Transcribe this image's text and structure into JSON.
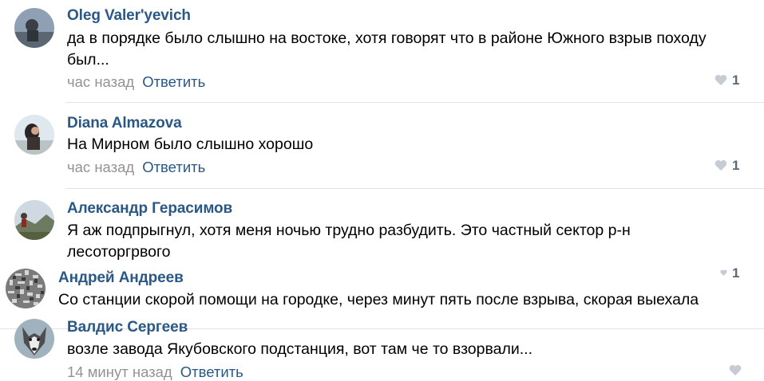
{
  "comments": [
    {
      "author": "Oleg Valer'yevich",
      "text_lines": [
        "да в порядке было слышно на востоке, хотя говорят что в районе Южного взрыв походу",
        "был..."
      ],
      "time": "час назад",
      "reply": "Ответить",
      "likes": "1"
    },
    {
      "author": "Diana Almazova",
      "text_lines": [
        "На Мирном было слышно хорошо"
      ],
      "time": "час назад",
      "reply": "Ответить",
      "likes": "1"
    },
    {
      "author": "Александр Герасимов",
      "text_lines": [
        "Я аж подпрыгнул, хотя меня ночью трудно разбудить. Это частный сектор р-н",
        "лесоторгрвого"
      ],
      "likes": "1"
    },
    {
      "author": "Андрей Андреев",
      "text_lines": [
        "Со станции скорой помощи на городке, через минут пять после взрыва, скорая выехала"
      ]
    },
    {
      "author": "Валдис Сергеев",
      "text_lines": [
        "возле завода Якубовского подстанция, вот там че то взорвали..."
      ],
      "time": "14 минут назад",
      "reply": "Ответить"
    }
  ],
  "icons": {
    "like": "heart-icon"
  },
  "colors": {
    "author": "#2a5885",
    "meta": "#939393",
    "separator": "#e1e3e6",
    "heart": "#c5ccd4"
  }
}
